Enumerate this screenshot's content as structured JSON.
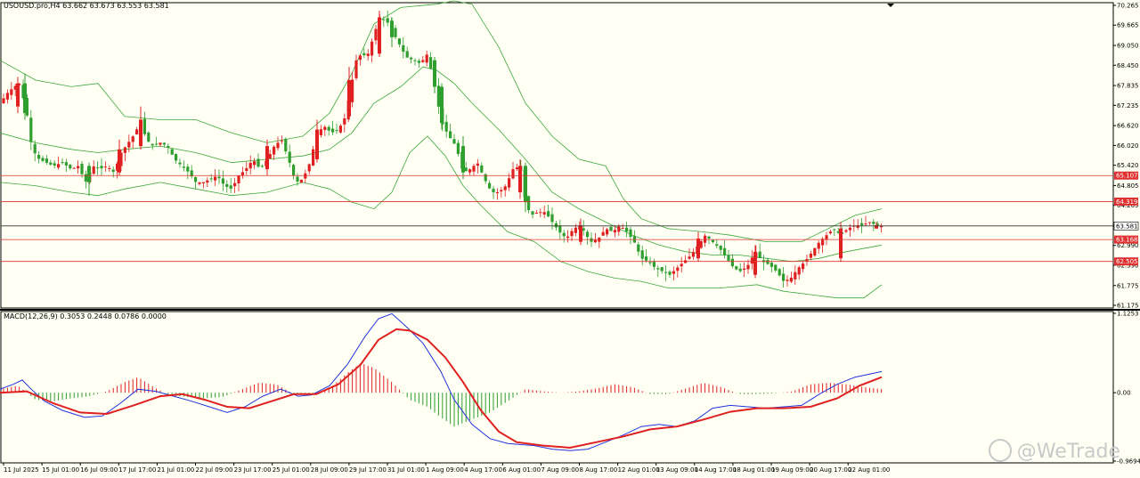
{
  "symbol_info": "USOUSD.pro,H4  63.662 63.673 63.553 63.581",
  "macd_info": "MACD(12,26,9) 0.3053 0.2448 0.0786 0.0000",
  "watermark": "@WeTrade",
  "colors": {
    "background": "#fffff4",
    "bull": "#e02020",
    "bear": "#2e9e2e",
    "bands": "#3aa83a",
    "level": "#e03030",
    "macd_main": "#2233dd",
    "macd_signal": "#e02020"
  },
  "chart_data": {
    "type": "candlestick",
    "price_axis_ticks": [
      "70.265",
      "69.665",
      "69.050",
      "68.450",
      "67.835",
      "67.235",
      "66.620",
      "66.020",
      "65.420",
      "64.805",
      "64.205",
      "63.590",
      "62.990",
      "62.390",
      "61.775",
      "61.175"
    ],
    "price_range": [
      61.175,
      70.265
    ],
    "current_price": "63.581",
    "level_lines": [
      {
        "price": 65.107,
        "label": "65.107"
      },
      {
        "price": 64.319,
        "label": "64.319"
      },
      {
        "price": 63.168,
        "label": "63.168"
      },
      {
        "price": 62.505,
        "label": "62.505"
      }
    ],
    "macd_axis_ticks": [
      "1.1253",
      "0.00",
      "-0.9694"
    ],
    "macd_range": [
      -0.9694,
      1.1253
    ],
    "time_labels": [
      "11 Jul 2025",
      "15 Jul 01:00",
      "16 Jul 09:00",
      "17 Jul 17:00",
      "21 Jul 01:00",
      "22 Jul 09:00",
      "23 Jul 17:00",
      "25 Jul 01:00",
      "28 Jul 09:00",
      "29 Jul 17:00",
      "31 Jul 01:00",
      "1 Aug 09:00",
      "4 Aug 17:00",
      "6 Aug 01:00",
      "7 Aug 09:00",
      "8 Aug 17:00",
      "12 Aug 01:00",
      "13 Aug 09:00",
      "14 Aug 17:00",
      "18 Aug 01:00",
      "19 Aug 09:00",
      "20 Aug 17:00",
      "22 Aug 01:00"
    ],
    "price_path": [
      [
        0,
        67.3
      ],
      [
        8,
        67.6
      ],
      [
        16,
        67.8
      ],
      [
        22,
        67.9
      ],
      [
        30,
        67.0
      ],
      [
        36,
        65.9
      ],
      [
        44,
        65.6
      ],
      [
        52,
        65.5
      ],
      [
        60,
        65.4
      ],
      [
        70,
        65.5
      ],
      [
        80,
        65.3
      ],
      [
        88,
        65.4
      ],
      [
        96,
        64.9
      ],
      [
        104,
        65.4
      ],
      [
        112,
        65.3
      ],
      [
        120,
        65.4
      ],
      [
        128,
        65.2
      ],
      [
        136,
        65.8
      ],
      [
        144,
        66.1
      ],
      [
        152,
        66.4
      ],
      [
        158,
        66.8
      ],
      [
        164,
        66.2
      ],
      [
        172,
        66.0
      ],
      [
        180,
        66.1
      ],
      [
        188,
        66.0
      ],
      [
        196,
        65.6
      ],
      [
        204,
        65.4
      ],
      [
        212,
        65.2
      ],
      [
        220,
        64.9
      ],
      [
        228,
        64.9
      ],
      [
        236,
        65.0
      ],
      [
        244,
        65.1
      ],
      [
        252,
        64.8
      ],
      [
        260,
        64.7
      ],
      [
        268,
        65.1
      ],
      [
        276,
        65.3
      ],
      [
        284,
        65.6
      ],
      [
        292,
        65.3
      ],
      [
        300,
        65.6
      ],
      [
        308,
        66.0
      ],
      [
        316,
        66.2
      ],
      [
        324,
        65.6
      ],
      [
        332,
        64.9
      ],
      [
        340,
        65.0
      ],
      [
        348,
        65.5
      ],
      [
        356,
        66.4
      ],
      [
        364,
        66.6
      ],
      [
        372,
        66.4
      ],
      [
        380,
        66.5
      ],
      [
        388,
        66.9
      ],
      [
        394,
        67.8
      ],
      [
        400,
        68.6
      ],
      [
        406,
        68.8
      ],
      [
        412,
        68.7
      ],
      [
        418,
        69.2
      ],
      [
        426,
        69.9
      ],
      [
        434,
        69.8
      ],
      [
        440,
        69.5
      ],
      [
        448,
        69.1
      ],
      [
        456,
        68.7
      ],
      [
        464,
        68.6
      ],
      [
        472,
        68.5
      ],
      [
        480,
        68.8
      ],
      [
        488,
        67.8
      ],
      [
        496,
        66.7
      ],
      [
        504,
        66.3
      ],
      [
        512,
        66.0
      ],
      [
        520,
        65.2
      ],
      [
        528,
        65.3
      ],
      [
        536,
        65.5
      ],
      [
        544,
        65.0
      ],
      [
        552,
        64.6
      ],
      [
        560,
        64.6
      ],
      [
        568,
        64.8
      ],
      [
        576,
        65.3
      ],
      [
        584,
        65.4
      ],
      [
        590,
        64.3
      ],
      [
        596,
        63.9
      ],
      [
        604,
        64.0
      ],
      [
        612,
        64.0
      ],
      [
        620,
        63.7
      ],
      [
        628,
        63.4
      ],
      [
        636,
        63.2
      ],
      [
        644,
        63.5
      ],
      [
        652,
        63.6
      ],
      [
        658,
        63.3
      ],
      [
        664,
        63.1
      ],
      [
        672,
        63.2
      ],
      [
        680,
        63.5
      ],
      [
        688,
        63.4
      ],
      [
        696,
        63.6
      ],
      [
        704,
        63.4
      ],
      [
        712,
        63.1
      ],
      [
        720,
        62.6
      ],
      [
        728,
        62.5
      ],
      [
        736,
        62.3
      ],
      [
        744,
        62.2
      ],
      [
        752,
        62.1
      ],
      [
        760,
        62.3
      ],
      [
        768,
        62.5
      ],
      [
        776,
        62.7
      ],
      [
        784,
        63.0
      ],
      [
        792,
        63.3
      ],
      [
        800,
        63.1
      ],
      [
        808,
        62.9
      ],
      [
        816,
        62.6
      ],
      [
        824,
        62.3
      ],
      [
        832,
        62.2
      ],
      [
        840,
        62.4
      ],
      [
        848,
        62.8
      ],
      [
        856,
        62.5
      ],
      [
        864,
        62.4
      ],
      [
        872,
        62.2
      ],
      [
        880,
        61.9
      ],
      [
        888,
        62.0
      ],
      [
        896,
        62.3
      ],
      [
        904,
        62.5
      ],
      [
        912,
        62.8
      ],
      [
        920,
        63.1
      ],
      [
        928,
        63.3
      ],
      [
        936,
        63.5
      ],
      [
        944,
        63.3
      ],
      [
        952,
        63.5
      ],
      [
        960,
        63.6
      ],
      [
        968,
        63.6
      ],
      [
        976,
        63.7
      ],
      [
        984,
        63.6
      ],
      [
        990,
        63.58
      ]
    ],
    "bb_upper": [
      [
        0,
        68.6
      ],
      [
        40,
        68.0
      ],
      [
        80,
        67.8
      ],
      [
        110,
        67.9
      ],
      [
        140,
        66.9
      ],
      [
        180,
        66.8
      ],
      [
        220,
        66.8
      ],
      [
        260,
        66.4
      ],
      [
        300,
        66.1
      ],
      [
        340,
        66.3
      ],
      [
        370,
        67.0
      ],
      [
        395,
        68.2
      ],
      [
        420,
        69.7
      ],
      [
        450,
        70.2
      ],
      [
        490,
        70.3
      ],
      [
        510,
        70.4
      ],
      [
        530,
        70.3
      ],
      [
        560,
        69.0
      ],
      [
        590,
        67.3
      ],
      [
        620,
        66.3
      ],
      [
        650,
        65.6
      ],
      [
        680,
        65.4
      ],
      [
        700,
        64.4
      ],
      [
        720,
        63.8
      ],
      [
        750,
        63.5
      ],
      [
        790,
        63.4
      ],
      [
        820,
        63.3
      ],
      [
        860,
        63.1
      ],
      [
        900,
        63.1
      ],
      [
        930,
        63.5
      ],
      [
        960,
        63.9
      ],
      [
        990,
        64.1
      ]
    ],
    "bb_middle": [
      [
        0,
        66.4
      ],
      [
        40,
        66.1
      ],
      [
        80,
        65.9
      ],
      [
        110,
        65.8
      ],
      [
        140,
        65.9
      ],
      [
        180,
        66.0
      ],
      [
        220,
        65.8
      ],
      [
        260,
        65.5
      ],
      [
        300,
        65.6
      ],
      [
        340,
        65.7
      ],
      [
        370,
        65.9
      ],
      [
        395,
        66.4
      ],
      [
        420,
        67.3
      ],
      [
        450,
        67.8
      ],
      [
        475,
        68.4
      ],
      [
        490,
        68.3
      ],
      [
        510,
        67.9
      ],
      [
        530,
        67.3
      ],
      [
        560,
        66.5
      ],
      [
        590,
        65.6
      ],
      [
        620,
        64.6
      ],
      [
        650,
        64.1
      ],
      [
        680,
        63.7
      ],
      [
        710,
        63.3
      ],
      [
        740,
        63.0
      ],
      [
        770,
        62.8
      ],
      [
        800,
        62.7
      ],
      [
        830,
        62.7
      ],
      [
        860,
        62.6
      ],
      [
        890,
        62.5
      ],
      [
        920,
        62.6
      ],
      [
        950,
        62.8
      ],
      [
        990,
        63.0
      ]
    ],
    "bb_lower": [
      [
        0,
        64.9
      ],
      [
        40,
        64.8
      ],
      [
        80,
        64.6
      ],
      [
        110,
        64.5
      ],
      [
        140,
        64.7
      ],
      [
        180,
        64.9
      ],
      [
        220,
        64.7
      ],
      [
        260,
        64.5
      ],
      [
        300,
        64.6
      ],
      [
        340,
        64.9
      ],
      [
        370,
        64.7
      ],
      [
        395,
        64.3
      ],
      [
        420,
        64.1
      ],
      [
        440,
        64.6
      ],
      [
        460,
        65.8
      ],
      [
        480,
        66.3
      ],
      [
        500,
        65.7
      ],
      [
        520,
        64.8
      ],
      [
        540,
        64.2
      ],
      [
        570,
        63.4
      ],
      [
        600,
        63.1
      ],
      [
        630,
        62.5
      ],
      [
        660,
        62.2
      ],
      [
        690,
        62.0
      ],
      [
        720,
        61.9
      ],
      [
        750,
        61.7
      ],
      [
        780,
        61.7
      ],
      [
        810,
        61.7
      ],
      [
        850,
        61.8
      ],
      [
        880,
        61.6
      ],
      [
        910,
        61.5
      ],
      [
        940,
        61.4
      ],
      [
        970,
        61.4
      ],
      [
        990,
        61.8
      ]
    ],
    "macd_main": [
      [
        0,
        0.05
      ],
      [
        15,
        0.12
      ],
      [
        25,
        0.18
      ],
      [
        35,
        0.05
      ],
      [
        50,
        -0.12
      ],
      [
        70,
        -0.25
      ],
      [
        95,
        -0.35
      ],
      [
        115,
        -0.33
      ],
      [
        135,
        -0.15
      ],
      [
        155,
        0.05
      ],
      [
        175,
        0.02
      ],
      [
        195,
        -0.05
      ],
      [
        215,
        -0.12
      ],
      [
        235,
        -0.2
      ],
      [
        255,
        -0.28
      ],
      [
        275,
        -0.2
      ],
      [
        295,
        -0.05
      ],
      [
        315,
        0.05
      ],
      [
        335,
        -0.05
      ],
      [
        350,
        -0.03
      ],
      [
        370,
        0.1
      ],
      [
        390,
        0.4
      ],
      [
        410,
        0.8
      ],
      [
        425,
        1.05
      ],
      [
        440,
        1.12
      ],
      [
        455,
        0.95
      ],
      [
        475,
        0.7
      ],
      [
        495,
        0.3
      ],
      [
        510,
        -0.1
      ],
      [
        530,
        -0.45
      ],
      [
        550,
        -0.65
      ],
      [
        570,
        -0.72
      ],
      [
        600,
        -0.75
      ],
      [
        620,
        -0.8
      ],
      [
        640,
        -0.82
      ],
      [
        660,
        -0.8
      ],
      [
        680,
        -0.7
      ],
      [
        700,
        -0.6
      ],
      [
        720,
        -0.48
      ],
      [
        740,
        -0.45
      ],
      [
        760,
        -0.48
      ],
      [
        780,
        -0.4
      ],
      [
        800,
        -0.22
      ],
      [
        820,
        -0.18
      ],
      [
        840,
        -0.2
      ],
      [
        860,
        -0.22
      ],
      [
        880,
        -0.2
      ],
      [
        900,
        -0.18
      ],
      [
        920,
        -0.02
      ],
      [
        940,
        0.12
      ],
      [
        960,
        0.22
      ],
      [
        990,
        0.3
      ]
    ],
    "macd_signal": [
      [
        0,
        0.0
      ],
      [
        30,
        0.02
      ],
      [
        60,
        -0.15
      ],
      [
        90,
        -0.28
      ],
      [
        120,
        -0.3
      ],
      [
        150,
        -0.18
      ],
      [
        180,
        -0.05
      ],
      [
        205,
        -0.02
      ],
      [
        230,
        -0.1
      ],
      [
        255,
        -0.2
      ],
      [
        280,
        -0.22
      ],
      [
        305,
        -0.12
      ],
      [
        330,
        -0.02
      ],
      [
        355,
        -0.02
      ],
      [
        380,
        0.12
      ],
      [
        405,
        0.4
      ],
      [
        425,
        0.75
      ],
      [
        445,
        0.9
      ],
      [
        460,
        0.88
      ],
      [
        480,
        0.75
      ],
      [
        500,
        0.5
      ],
      [
        520,
        0.15
      ],
      [
        540,
        -0.25
      ],
      [
        560,
        -0.55
      ],
      [
        580,
        -0.7
      ],
      [
        610,
        -0.75
      ],
      [
        640,
        -0.78
      ],
      [
        670,
        -0.7
      ],
      [
        700,
        -0.62
      ],
      [
        730,
        -0.52
      ],
      [
        760,
        -0.48
      ],
      [
        790,
        -0.38
      ],
      [
        820,
        -0.27
      ],
      [
        850,
        -0.22
      ],
      [
        880,
        -0.22
      ],
      [
        910,
        -0.2
      ],
      [
        940,
        -0.08
      ],
      [
        965,
        0.1
      ],
      [
        990,
        0.22
      ]
    ],
    "macd_hist": [
      [
        0,
        0.05
      ],
      [
        20,
        0.1
      ],
      [
        40,
        -0.1
      ],
      [
        60,
        -0.12
      ],
      [
        80,
        -0.08
      ],
      [
        100,
        -0.05
      ],
      [
        120,
        0.02
      ],
      [
        140,
        0.15
      ],
      [
        155,
        0.22
      ],
      [
        170,
        0.1
      ],
      [
        190,
        -0.04
      ],
      [
        210,
        -0.06
      ],
      [
        230,
        -0.08
      ],
      [
        250,
        -0.06
      ],
      [
        270,
        0.04
      ],
      [
        290,
        0.14
      ],
      [
        310,
        0.12
      ],
      [
        330,
        -0.02
      ],
      [
        350,
        -0.02
      ],
      [
        370,
        0.06
      ],
      [
        390,
        0.28
      ],
      [
        405,
        0.42
      ],
      [
        420,
        0.35
      ],
      [
        440,
        0.15
      ],
      [
        460,
        -0.1
      ],
      [
        480,
        -0.2
      ],
      [
        495,
        -0.35
      ],
      [
        510,
        -0.48
      ],
      [
        530,
        -0.38
      ],
      [
        550,
        -0.28
      ],
      [
        570,
        -0.12
      ],
      [
        590,
        0.05
      ],
      [
        610,
        0.02
      ],
      [
        630,
        0.0
      ],
      [
        650,
        0.02
      ],
      [
        670,
        0.06
      ],
      [
        690,
        0.12
      ],
      [
        710,
        0.08
      ],
      [
        730,
        -0.02
      ],
      [
        750,
        -0.02
      ],
      [
        770,
        0.06
      ],
      [
        790,
        0.14
      ],
      [
        810,
        0.08
      ],
      [
        830,
        -0.02
      ],
      [
        850,
        -0.02
      ],
      [
        870,
        -0.01
      ],
      [
        890,
        0.02
      ],
      [
        910,
        0.12
      ],
      [
        930,
        0.14
      ],
      [
        950,
        0.12
      ],
      [
        970,
        0.08
      ],
      [
        990,
        0.05
      ]
    ],
    "candle_samples": [
      [
        20,
        67.2,
        67.9,
        68.1,
        67.0
      ],
      [
        28,
        67.9,
        67.0,
        68.2,
        66.8
      ],
      [
        100,
        65.4,
        64.9,
        65.5,
        64.5
      ],
      [
        134,
        65.2,
        65.9,
        66.2,
        65.1
      ],
      [
        158,
        66.0,
        66.8,
        67.2,
        65.9
      ],
      [
        300,
        65.3,
        66.0,
        66.2,
        65.1
      ],
      [
        356,
        65.6,
        66.5,
        66.8,
        65.5
      ],
      [
        392,
        66.9,
        68.0,
        68.4,
        66.8
      ],
      [
        426,
        68.8,
        69.9,
        70.1,
        68.7
      ],
      [
        440,
        69.8,
        69.3,
        69.9,
        69.0
      ],
      [
        488,
        68.6,
        67.8,
        68.7,
        67.6
      ],
      [
        496,
        67.8,
        66.7,
        67.9,
        66.5
      ],
      [
        520,
        66.0,
        65.2,
        66.3,
        65.0
      ],
      [
        584,
        64.6,
        65.4,
        65.6,
        64.4
      ],
      [
        590,
        65.4,
        64.3,
        65.5,
        64.0
      ],
      [
        652,
        63.1,
        63.6,
        63.8,
        63.0
      ],
      [
        784,
        62.6,
        63.2,
        63.4,
        62.5
      ],
      [
        848,
        62.1,
        62.8,
        63.0,
        62.0
      ],
      [
        944,
        62.6,
        63.5,
        63.7,
        62.5
      ],
      [
        984,
        63.5,
        63.6,
        63.7,
        63.5
      ]
    ]
  }
}
